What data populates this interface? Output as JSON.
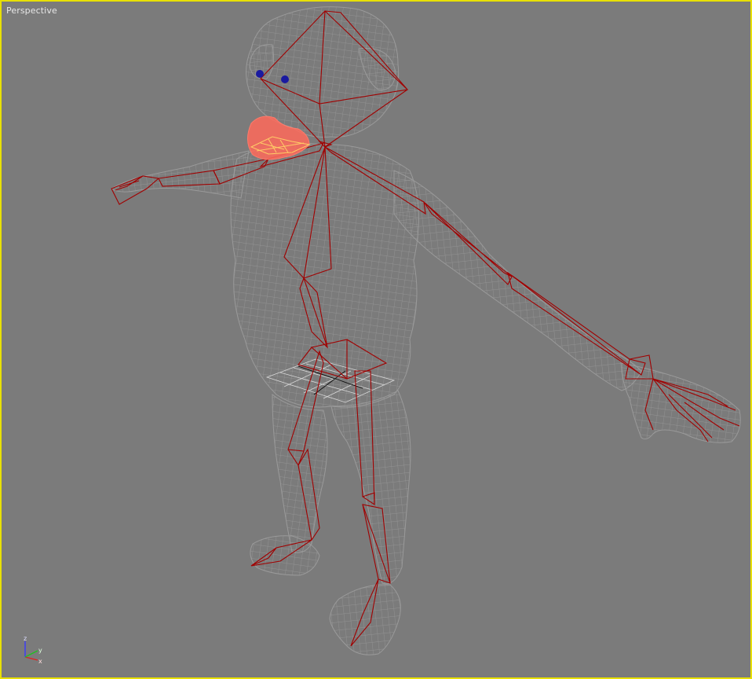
{
  "viewport": {
    "label": "Perspective",
    "active_border_color": "#e8e000",
    "background_color": "#7b7b7b"
  },
  "scene": {
    "mesh_wire_color": "#9a9a9a",
    "bone_color": "#a10000",
    "eye_color": "#1a1aa0",
    "selected_highlight_color": "#ff6a5a",
    "selected_wire_color": "#ffcc66",
    "helper_color": "#d8d8d8"
  },
  "axis_gizmo": {
    "z_label": "z",
    "y_label": "y",
    "x_label": "x"
  }
}
